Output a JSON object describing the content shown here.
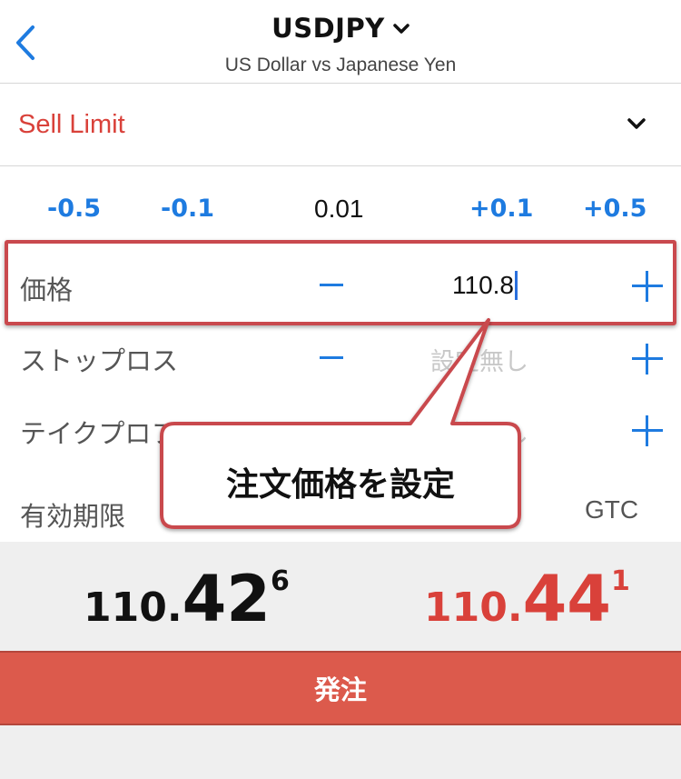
{
  "header": {
    "symbol": "USDJPY",
    "subtitle": "US Dollar vs Japanese Yen"
  },
  "order_type": {
    "label": "Sell Limit"
  },
  "steps": {
    "minus_large": "-0.5",
    "minus_small": "-0.1",
    "step_value": "0.01",
    "plus_small": "+0.1",
    "plus_large": "+0.5"
  },
  "fields": {
    "price": {
      "label": "価格",
      "value": "110.8"
    },
    "stop_loss": {
      "label": "ストップロス",
      "placeholder": "設定無し"
    },
    "take_profit": {
      "label": "テイクプロフィット",
      "placeholder": "設定無し"
    },
    "expiration": {
      "label": "有効期限",
      "value": "GTC"
    }
  },
  "callout": {
    "text": "注文価格を設定"
  },
  "quotes": {
    "bid": {
      "base": "110.",
      "big": "42",
      "sup": "6"
    },
    "ask": {
      "base": "110.",
      "big": "44",
      "sup": "1"
    }
  },
  "order_button": {
    "label": "発注"
  },
  "colors": {
    "accent_blue": "#1e7be0",
    "sell_red": "#d9413a",
    "button_red": "#dc5a4c",
    "highlight_border": "#c9494e"
  }
}
